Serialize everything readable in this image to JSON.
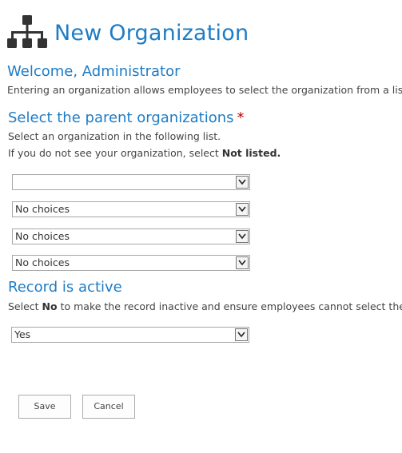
{
  "header": {
    "title": "New Organization",
    "icon": "organization-hierarchy-icon"
  },
  "welcome": "Welcome, Administrator",
  "intro": "Entering an organization allows employees to select the organization from a list when",
  "parent_section": {
    "title": "Select the parent organizations",
    "required_mark": "*",
    "help_1": "Select an organization in the following list.",
    "help_2_prefix": "If you do not see your organization, select ",
    "help_2_bold": "Not listed.",
    "selects": [
      {
        "value": ""
      },
      {
        "value": "No choices"
      },
      {
        "value": "No choices"
      },
      {
        "value": "No choices"
      }
    ]
  },
  "active_section": {
    "title": "Record is active",
    "help_prefix": "Select ",
    "help_bold": "No",
    "help_suffix": " to make the record inactive and ensure employees cannot select the organiz",
    "select_value": "Yes"
  },
  "buttons": {
    "save": "Save",
    "cancel": "Cancel"
  },
  "colors": {
    "accent": "#1e7cc5",
    "required": "#bf0000"
  }
}
